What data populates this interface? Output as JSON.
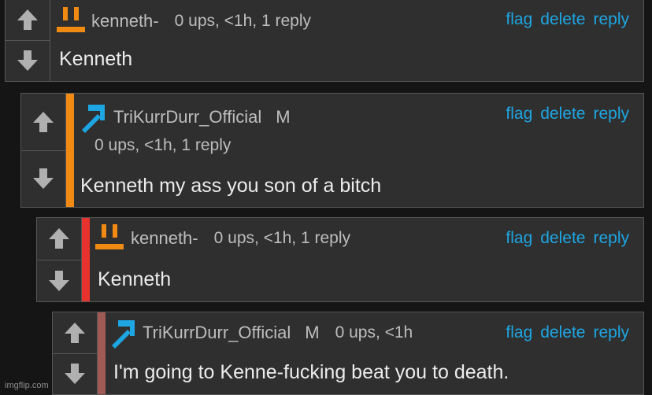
{
  "comments": [
    {
      "username": "kenneth-",
      "badge": "",
      "meta": "0 ups, <1h, 1 reply",
      "text": "Kenneth",
      "stripe_color": "",
      "user_icon": "orange-face-icon",
      "actions": {
        "flag": "flag",
        "delete": "delete",
        "reply": "reply"
      }
    },
    {
      "username": "TriKurrDurr_Official",
      "badge": "M",
      "meta": "0 ups, <1h, 1 reply",
      "text": "Kenneth my ass you son of a bitch",
      "stripe_color": "#f08a12",
      "user_icon": "blue-pickaxe-icon",
      "actions": {
        "flag": "flag",
        "delete": "delete",
        "reply": "reply"
      }
    },
    {
      "username": "kenneth-",
      "badge": "",
      "meta": "0 ups, <1h, 1 reply",
      "text": "Kenneth",
      "stripe_color": "#e8322e",
      "user_icon": "orange-face-icon",
      "actions": {
        "flag": "flag",
        "delete": "delete",
        "reply": "reply"
      }
    },
    {
      "username": "TriKurrDurr_Official",
      "badge": "M",
      "meta": "0 ups, <1h",
      "text": "I'm going to Kenne-fucking beat you to death.",
      "stripe_color": "#a05a55",
      "user_icon": "blue-pickaxe-icon",
      "actions": {
        "flag": "flag",
        "delete": "delete",
        "reply": "reply"
      }
    }
  ],
  "colors": {
    "link": "#1ea6e3",
    "background": "#151515",
    "panel": "#2f2f2f"
  },
  "watermark": "imgflip.com"
}
